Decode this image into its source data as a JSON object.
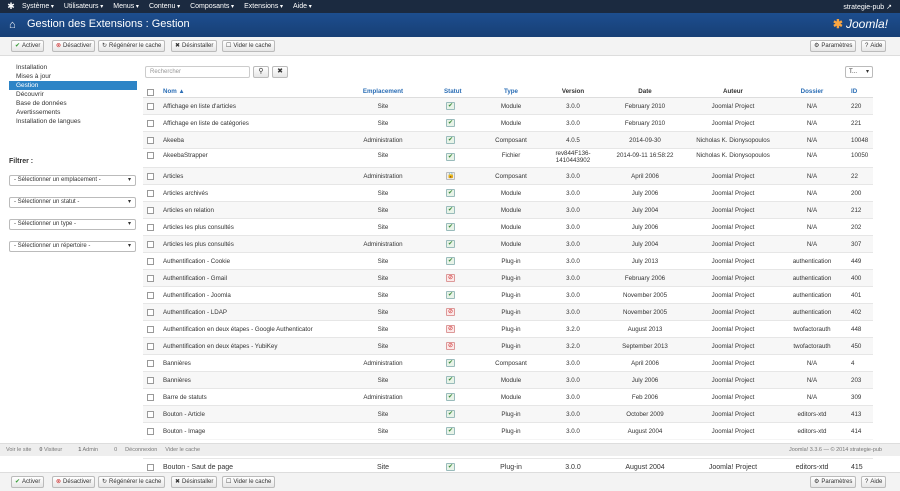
{
  "topbar": {
    "menus": [
      "Système",
      "Utilisateurs",
      "Menus",
      "Contenu",
      "Composants",
      "Extensions",
      "Aide"
    ],
    "user": "strategie-pub ↗"
  },
  "header": {
    "title": "Gestion des Extensions : Gestion",
    "logo": "Joomla!"
  },
  "toolbar": {
    "activer": "Activer",
    "desactiver": "Désactiver",
    "regenerer": "Régénérer le cache",
    "desinstaller": "Désinstaller",
    "vider": "Vider le cache",
    "parametres": "Paramètres",
    "aide": "Aide"
  },
  "sidebar": {
    "items": [
      "Installation",
      "Mises à jour",
      "Gestion",
      "Découvrir",
      "Base de données",
      "Avertissements",
      "Installation de langues"
    ],
    "filter_title": "Filtrer :",
    "selects": [
      "- Sélectionner un emplacement -",
      "- Sélectionner un statut -",
      "- Sélectionner un type -",
      "- Sélectionner un répertoire -"
    ]
  },
  "search": {
    "placeholder": "Rechercher",
    "sort": "T..."
  },
  "columns": {
    "nom": "Nom ▲",
    "emplacement": "Emplacement",
    "statut": "Statut",
    "type": "Type",
    "version": "Version",
    "date": "Date",
    "auteur": "Auteur",
    "dossier": "Dossier",
    "id": "ID"
  },
  "rows": [
    {
      "nom": "Affichage en liste d'articles",
      "emp": "Site",
      "st": "on",
      "type": "Module",
      "ver": "3.0.0",
      "date": "February 2010",
      "aut": "Joomla! Project",
      "dos": "N/A",
      "id": "220"
    },
    {
      "nom": "Affichage en liste de catégories",
      "emp": "Site",
      "st": "on",
      "type": "Module",
      "ver": "3.0.0",
      "date": "February 2010",
      "aut": "Joomla! Project",
      "dos": "N/A",
      "id": "221"
    },
    {
      "nom": "Akeeba",
      "emp": "Administration",
      "st": "on",
      "type": "Composant",
      "ver": "4.0.5",
      "date": "2014-09-30",
      "aut": "Nicholas K. Dionysopoulos",
      "dos": "N/A",
      "id": "10048"
    },
    {
      "nom": "AkeebaStrapper",
      "emp": "Site",
      "st": "on",
      "type": "Fichier",
      "ver": "rev844F136-1410443902",
      "date": "2014-09-11 16:58:22",
      "aut": "Nicholas K. Dionysopoulos",
      "dos": "N/A",
      "id": "10050"
    },
    {
      "nom": "Articles",
      "emp": "Administration",
      "st": "lock",
      "type": "Composant",
      "ver": "3.0.0",
      "date": "April 2006",
      "aut": "Joomla! Project",
      "dos": "N/A",
      "id": "22"
    },
    {
      "nom": "Articles archivés",
      "emp": "Site",
      "st": "on",
      "type": "Module",
      "ver": "3.0.0",
      "date": "July 2006",
      "aut": "Joomla! Project",
      "dos": "N/A",
      "id": "200"
    },
    {
      "nom": "Articles en relation",
      "emp": "Site",
      "st": "on",
      "type": "Module",
      "ver": "3.0.0",
      "date": "July 2004",
      "aut": "Joomla! Project",
      "dos": "N/A",
      "id": "212"
    },
    {
      "nom": "Articles les plus consultés",
      "emp": "Site",
      "st": "on",
      "type": "Module",
      "ver": "3.0.0",
      "date": "July 2006",
      "aut": "Joomla! Project",
      "dos": "N/A",
      "id": "202"
    },
    {
      "nom": "Articles les plus consultés",
      "emp": "Administration",
      "st": "on",
      "type": "Module",
      "ver": "3.0.0",
      "date": "July 2004",
      "aut": "Joomla! Project",
      "dos": "N/A",
      "id": "307"
    },
    {
      "nom": "Authentification - Cookie",
      "emp": "Site",
      "st": "on",
      "type": "Plug-in",
      "ver": "3.0.0",
      "date": "July 2013",
      "aut": "Joomla! Project",
      "dos": "authentication",
      "id": "449"
    },
    {
      "nom": "Authentification - Gmail",
      "emp": "Site",
      "st": "off",
      "type": "Plug-in",
      "ver": "3.0.0",
      "date": "February 2006",
      "aut": "Joomla! Project",
      "dos": "authentication",
      "id": "400"
    },
    {
      "nom": "Authentification - Joomla",
      "emp": "Site",
      "st": "on",
      "type": "Plug-in",
      "ver": "3.0.0",
      "date": "November 2005",
      "aut": "Joomla! Project",
      "dos": "authentication",
      "id": "401"
    },
    {
      "nom": "Authentification - LDAP",
      "emp": "Site",
      "st": "off",
      "type": "Plug-in",
      "ver": "3.0.0",
      "date": "November 2005",
      "aut": "Joomla! Project",
      "dos": "authentication",
      "id": "402"
    },
    {
      "nom": "Authentification en deux étapes - Google Authenticator",
      "emp": "Site",
      "st": "off",
      "type": "Plug-in",
      "ver": "3.2.0",
      "date": "August 2013",
      "aut": "Joomla! Project",
      "dos": "twofactorauth",
      "id": "448"
    },
    {
      "nom": "Authentification en deux étapes - YubiKey",
      "emp": "Site",
      "st": "off",
      "type": "Plug-in",
      "ver": "3.2.0",
      "date": "September 2013",
      "aut": "Joomla! Project",
      "dos": "twofactorauth",
      "id": "450"
    },
    {
      "nom": "Bannières",
      "emp": "Administration",
      "st": "on",
      "type": "Composant",
      "ver": "3.0.0",
      "date": "April 2006",
      "aut": "Joomla! Project",
      "dos": "N/A",
      "id": "4"
    },
    {
      "nom": "Bannières",
      "emp": "Site",
      "st": "on",
      "type": "Module",
      "ver": "3.0.0",
      "date": "July 2006",
      "aut": "Joomla! Project",
      "dos": "N/A",
      "id": "203"
    },
    {
      "nom": "Barre de statuts",
      "emp": "Administration",
      "st": "on",
      "type": "Module",
      "ver": "3.0.0",
      "date": "Feb 2006",
      "aut": "Joomla! Project",
      "dos": "N/A",
      "id": "309"
    },
    {
      "nom": "Bouton - Article",
      "emp": "Site",
      "st": "on",
      "type": "Plug-in",
      "ver": "3.0.0",
      "date": "October 2009",
      "aut": "Joomla! Project",
      "dos": "editors-xtd",
      "id": "413"
    },
    {
      "nom": "Bouton - Image",
      "emp": "Site",
      "st": "on",
      "type": "Plug-in",
      "ver": "3.0.0",
      "date": "August 2004",
      "aut": "Joomla! Project",
      "dos": "editors-xtd",
      "id": "414"
    }
  ],
  "last_row": {
    "nom": "Bouton - Saut de page",
    "emp": "Site",
    "st": "on",
    "type": "Plug-in",
    "ver": "3.0.0",
    "date": "August 2004",
    "aut": "Joomla! Project",
    "dos": "editors-xtd",
    "id": "415"
  },
  "status": {
    "voir": "Voir le site",
    "visiteur_count": "0",
    "visiteur": "Visiteur",
    "admin_count": "1",
    "admin": "Admin",
    "msg_count": "0",
    "deconnexion": "Déconnexion",
    "vider": "Vider le cache",
    "right": "Joomla! 3.3.6 — © 2014 strategie-pub"
  }
}
